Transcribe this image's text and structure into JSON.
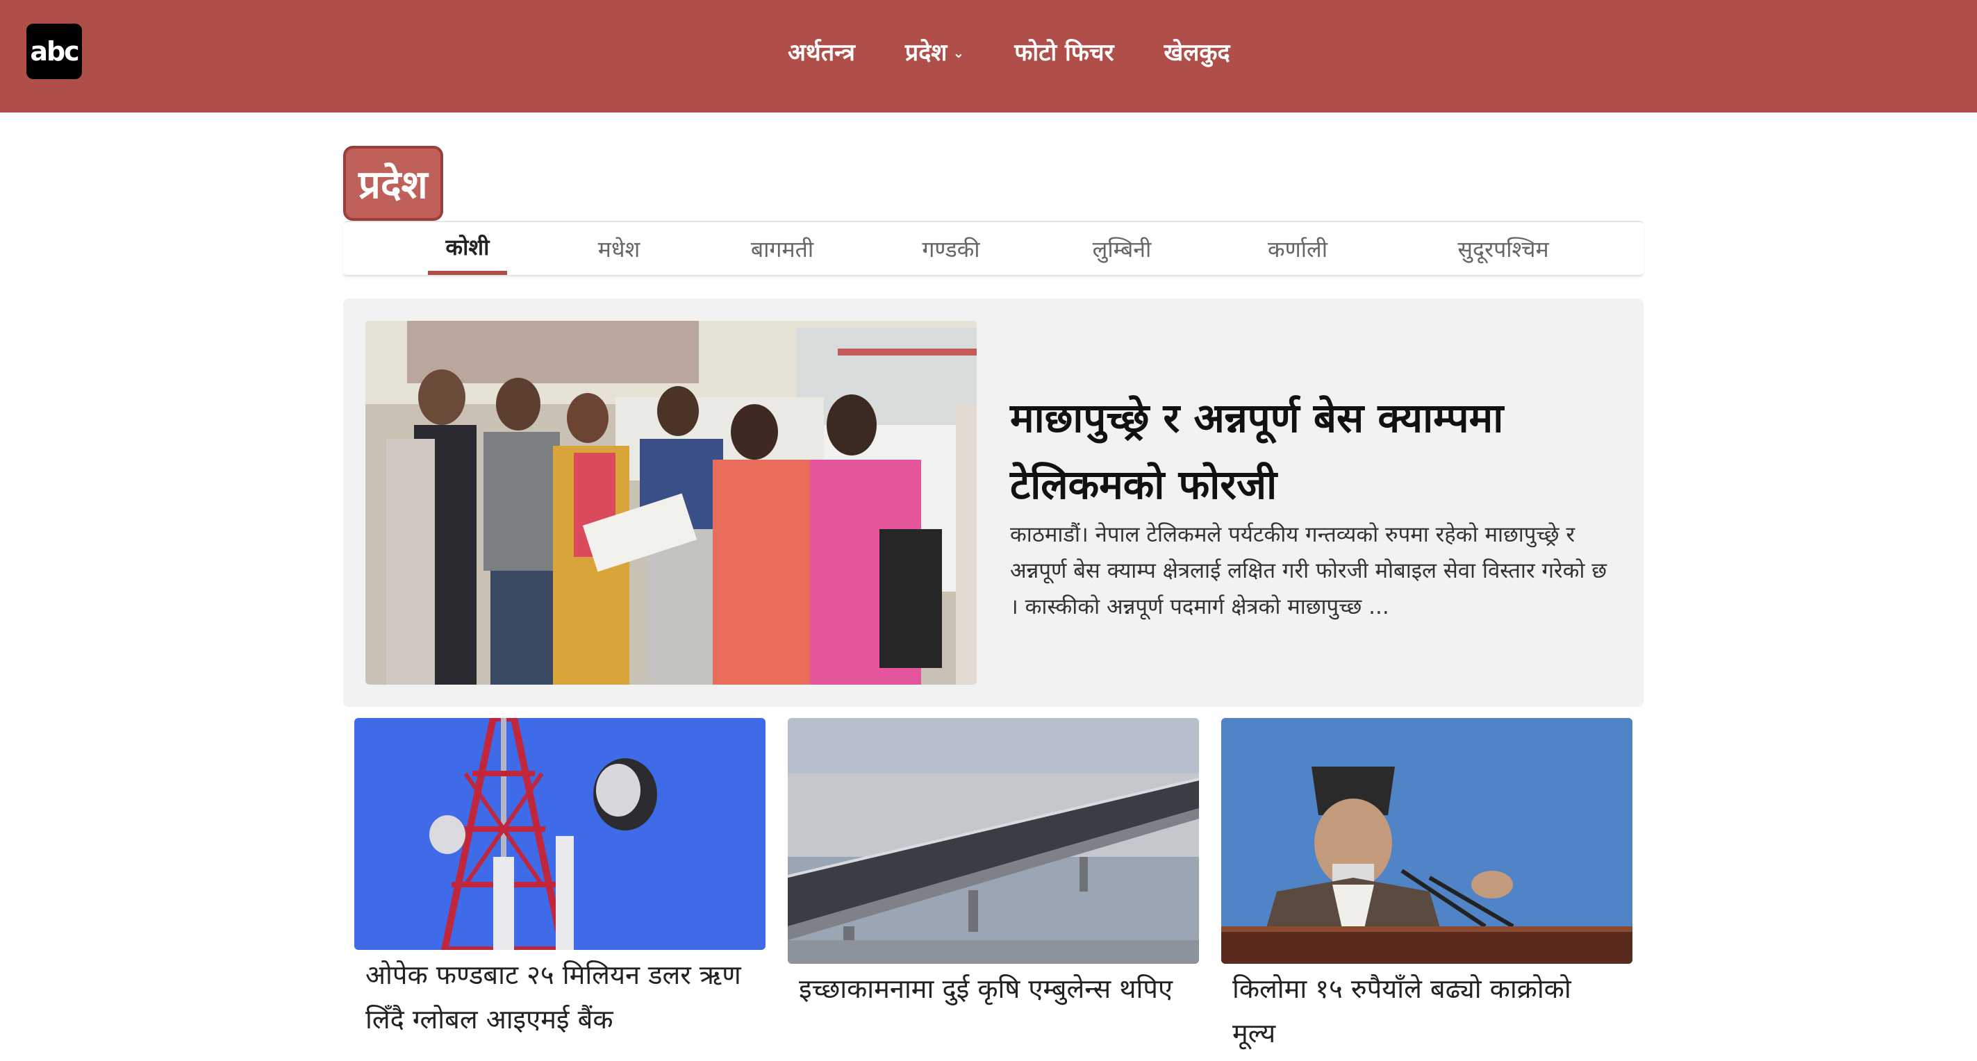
{
  "header": {
    "logo_text": "abc",
    "nav": [
      {
        "label": "अर्थतन्त्र",
        "has_dropdown": false
      },
      {
        "label": "प्रदेश",
        "has_dropdown": true
      },
      {
        "label": "फोटो फिचर",
        "has_dropdown": false
      },
      {
        "label": "खेलकुद",
        "has_dropdown": false
      }
    ]
  },
  "section": {
    "title": "प्रदेश",
    "tabs": [
      {
        "label": "कोशी",
        "active": true
      },
      {
        "label": "मधेश",
        "active": false
      },
      {
        "label": "बागमती",
        "active": false
      },
      {
        "label": "गण्डकी",
        "active": false
      },
      {
        "label": "लुम्बिनी",
        "active": false
      },
      {
        "label": "कर्णाली",
        "active": false
      },
      {
        "label": "सुदूरपश्चिम",
        "active": false
      }
    ]
  },
  "featured": {
    "title": "माछापुच्छ्रे र अन्नपूर्ण बेस क्याम्पमा टेलिकमको फोरजी",
    "excerpt": "काठमाडौं। नेपाल टेलिकमले पर्यटकीय गन्तव्यको रुपमा रहेको माछापुच्छ्रे र अन्नपूर्ण बेस क्याम्प क्षेत्रलाई लक्षित गरी फोरजी मोबाइल सेवा विस्तार गरेको छ । कास्कीको अन्नपूर्ण पदमार्ग क्षेत्रको माछापुच्छ ..."
  },
  "cards": [
    {
      "title": "ओपेक फण्डबाट २५ मिलियन डलर ऋण लिँदै ग्लोबल आइएमई बैंक"
    },
    {
      "title": "इच्छाकामनामा दुई कृषि एम्बुलेन्स थपिए"
    },
    {
      "title": "किलोमा १५ रुपैयाँले बढ्यो काक्रोको मूल्य"
    }
  ],
  "colors": {
    "brand": "#b04f4a",
    "section_tag": "#c0605a",
    "featured_bg": "#f2f2f3"
  }
}
